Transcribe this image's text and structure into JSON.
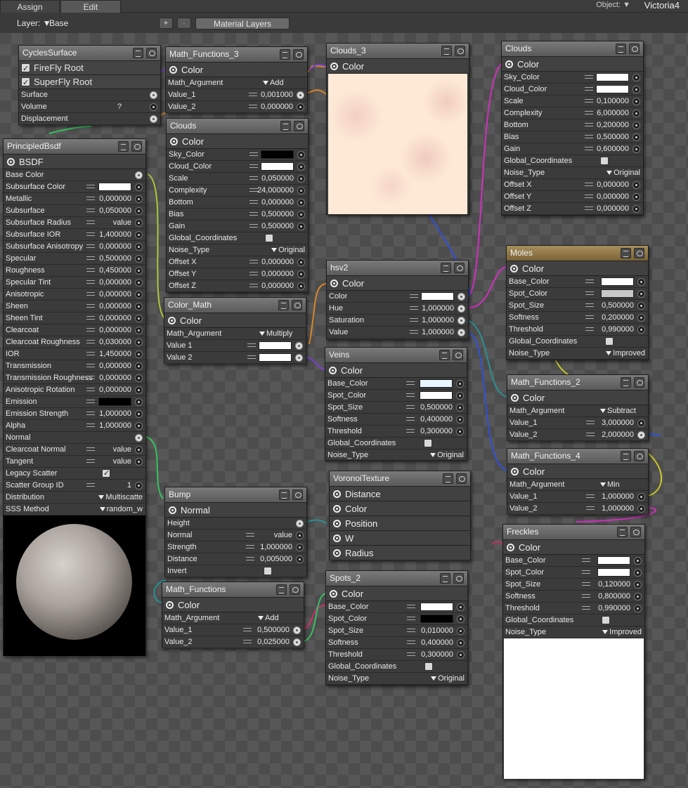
{
  "topbar": {
    "tab_assign": "Assign",
    "tab_edit": "Edit",
    "object_label": "Object:",
    "object_value": "Victoria4"
  },
  "layerbar": {
    "layer_label": "Layer:",
    "layer_value": "Base",
    "plus": "+",
    "minus": "-",
    "material_layers": "Material Layers"
  },
  "nodes": {
    "cycles_surface": {
      "title": "CyclesSurface",
      "firefly": "FireFly Root",
      "superfly": "SuperFly Root",
      "surface": "Surface",
      "volume": "Volume",
      "volume_val": "?",
      "displacement": "Displacement"
    },
    "math_functions_3": {
      "title": "Math_Functions_3",
      "out": "Color",
      "arg": "Math_Argument",
      "arg_val": "Add",
      "v1": "Value_1",
      "v1_val": "0,001000",
      "v2": "Value_2",
      "v2_val": "0,000000"
    },
    "clouds_3": {
      "title": "Clouds_3",
      "out": "Color"
    },
    "clouds_right": {
      "title": "Clouds",
      "out": "Color",
      "rows": [
        [
          "Sky_Color",
          ""
        ],
        [
          "Cloud_Color",
          ""
        ],
        [
          "Scale",
          "0,100000"
        ],
        [
          "Complexity",
          "6,000000"
        ],
        [
          "Bottom",
          "0,200000"
        ],
        [
          "Bias",
          "0,500000"
        ],
        [
          "Gain",
          "0,600000"
        ],
        [
          "Global_Coordinates",
          ""
        ],
        [
          "Noise_Type",
          "Original"
        ],
        [
          "Offset X",
          "0,000000"
        ],
        [
          "Offset Y",
          "0,000000"
        ],
        [
          "Offset Z",
          "0,000000"
        ]
      ]
    },
    "clouds_mid": {
      "title": "Clouds",
      "out": "Color",
      "rows": [
        [
          "Sky_Color",
          ""
        ],
        [
          "Cloud_Color",
          ""
        ],
        [
          "Scale",
          "0,050000"
        ],
        [
          "Complexity",
          "24,000000"
        ],
        [
          "Bottom",
          "0,000000"
        ],
        [
          "Bias",
          "0,500000"
        ],
        [
          "Gain",
          "0,500000"
        ],
        [
          "Global_Coordinates",
          ""
        ],
        [
          "Noise_Type",
          "Original"
        ],
        [
          "Offset X",
          "0,000000"
        ],
        [
          "Offset Y",
          "0,000000"
        ],
        [
          "Offset Z",
          "0,000000"
        ]
      ]
    },
    "principled": {
      "title": "PrincipledBsdf",
      "out": "BSDF",
      "rows": [
        [
          "Base Color",
          ""
        ],
        [
          "Subsurface Color",
          ""
        ],
        [
          "Metallic",
          "0,000000"
        ],
        [
          "Subsurface",
          "0,050000"
        ],
        [
          "Subsurface Radius",
          "value"
        ],
        [
          "Subsurface IOR",
          "1,400000"
        ],
        [
          "Subsurface Anisotropy",
          "0,000000"
        ],
        [
          "Specular",
          "0,500000"
        ],
        [
          "Roughness",
          "0,450000"
        ],
        [
          "Specular Tint",
          "0,000000"
        ],
        [
          "Anisotropic",
          "0,000000"
        ],
        [
          "Sheen",
          "0,000000"
        ],
        [
          "Sheen Tint",
          "0,000000"
        ],
        [
          "Clearcoat",
          "0,000000"
        ],
        [
          "Clearcoat Roughness",
          "0,030000"
        ],
        [
          "IOR",
          "1,450000"
        ],
        [
          "Transmission",
          "0,000000"
        ],
        [
          "Transmission Roughness",
          "0,000000"
        ],
        [
          "Anisotropic Rotation",
          "0,000000"
        ],
        [
          "Emission",
          ""
        ],
        [
          "Emission Strength",
          "1,000000"
        ],
        [
          "Alpha",
          "1,000000"
        ],
        [
          "Normal",
          ""
        ],
        [
          "Clearcoat Normal",
          "value"
        ],
        [
          "Tangent",
          "value"
        ],
        [
          "Legacy Scatter",
          ""
        ],
        [
          "Scatter Group ID",
          "1"
        ],
        [
          "Distribution",
          "Multiscatte"
        ],
        [
          "SSS Method",
          "random_w"
        ]
      ]
    },
    "hsv2": {
      "title": "hsv2",
      "out": "Color",
      "rows": [
        [
          "Color",
          ""
        ],
        [
          "Hue",
          "1,000000"
        ],
        [
          "Saturation",
          "1,000000"
        ],
        [
          "Value",
          "1,000000"
        ]
      ]
    },
    "moles": {
      "title": "Moles",
      "out": "Color",
      "rows": [
        [
          "Base_Color",
          ""
        ],
        [
          "Spot_Color",
          ""
        ],
        [
          "Spot_Size",
          "0,500000"
        ],
        [
          "Softness",
          "0,200000"
        ],
        [
          "Threshold",
          "0,990000"
        ],
        [
          "Global_Coordinates",
          ""
        ],
        [
          "Noise_Type",
          "Improved"
        ]
      ]
    },
    "color_math": {
      "title": "Color_Math",
      "out": "Color",
      "arg": "Math_Argument",
      "arg_val": "Multiply",
      "v1": "Value 1",
      "v2": "Value 2"
    },
    "veins": {
      "title": "Veins",
      "out": "Color",
      "rows": [
        [
          "Base_Color",
          ""
        ],
        [
          "Spot_Color",
          ""
        ],
        [
          "Spot_Size",
          "0,500000"
        ],
        [
          "Softness",
          "0,400000"
        ],
        [
          "Threshold",
          "0,300000"
        ],
        [
          "Global_Coordinates",
          ""
        ],
        [
          "Noise_Type",
          "Original"
        ]
      ]
    },
    "math_functions_2": {
      "title": "Math_Functions_2",
      "out": "Color",
      "arg": "Math_Argument",
      "arg_val": "Subtract",
      "v1": "Value_1",
      "v1_val": "3,000000",
      "v2": "Value_2",
      "v2_val": "2,000000"
    },
    "math_functions_4": {
      "title": "Math_Functions_4",
      "out": "Color",
      "arg": "Math_Argument",
      "arg_val": "Min",
      "v1": "Value_1",
      "v1_val": "1,000000",
      "v2": "Value_2",
      "v2_val": "1,000000"
    },
    "voronoi": {
      "title": "VoronoiTexture",
      "outs": [
        "Distance",
        "Color",
        "Position",
        "W",
        "Radius"
      ]
    },
    "bump": {
      "title": "Bump",
      "out": "Normal",
      "rows": [
        [
          "Height",
          ""
        ],
        [
          "Normal",
          "value"
        ],
        [
          "Strength",
          "1,000000"
        ],
        [
          "Distance",
          "0,005000"
        ],
        [
          "Invert",
          ""
        ]
      ]
    },
    "freckles": {
      "title": "Freckles",
      "out": "Color",
      "rows": [
        [
          "Base_Color",
          ""
        ],
        [
          "Spot_Color",
          ""
        ],
        [
          "Spot_Size",
          "0,120000"
        ],
        [
          "Softness",
          "0,800000"
        ],
        [
          "Threshold",
          "0,990000"
        ],
        [
          "Global_Coordinates",
          ""
        ],
        [
          "Noise_Type",
          "Improved"
        ]
      ]
    },
    "math_functions": {
      "title": "Math_Functions",
      "out": "Color",
      "arg": "Math_Argument",
      "arg_val": "Add",
      "v1": "Value_1",
      "v1_val": "0,500000",
      "v2": "Value_2",
      "v2_val": "0,025000"
    },
    "spots_2": {
      "title": "Spots_2",
      "out": "Color",
      "rows": [
        [
          "Base_Color",
          ""
        ],
        [
          "Spot_Color",
          ""
        ],
        [
          "Spot_Size",
          "0,010000"
        ],
        [
          "Softness",
          "0,400000"
        ],
        [
          "Threshold",
          "0,300000"
        ],
        [
          "Global_Coordinates",
          ""
        ],
        [
          "Noise_Type",
          "Original"
        ]
      ]
    }
  },
  "colors": {
    "wire_orange": "#d8862a",
    "wire_purple": "#7a3fd0",
    "wire_magenta": "#d030c0",
    "wire_green": "#38c060",
    "wire_teal": "#2a9090",
    "wire_yellow": "#c8c828",
    "wire_blue": "#3050d8",
    "wire_pink": "#c83068"
  }
}
